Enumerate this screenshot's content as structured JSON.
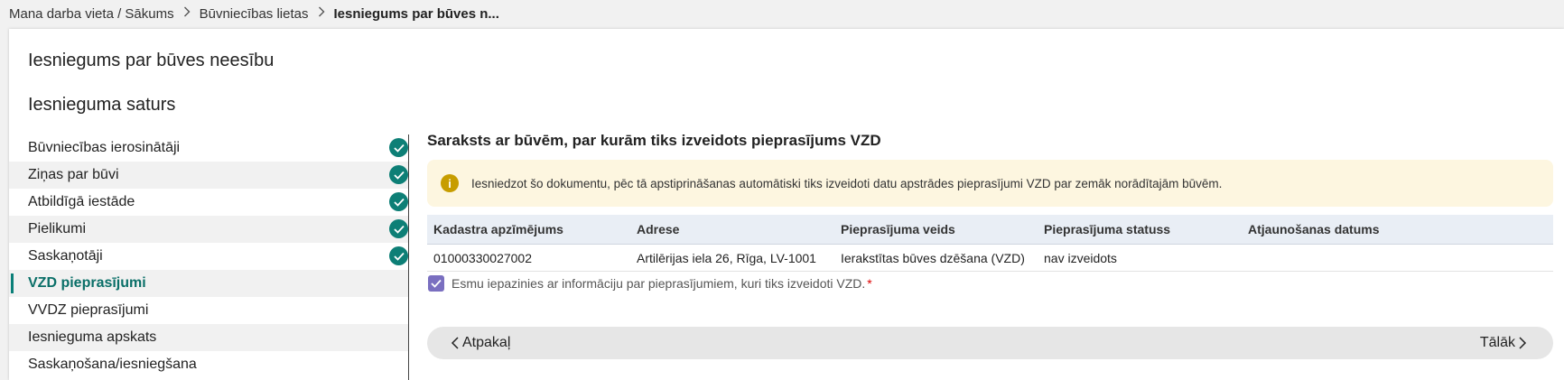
{
  "breadcrumb": {
    "home": "Mana darba vieta / Sākums",
    "section": "Būvniecības lietas",
    "current": "Iesniegums par būves n..."
  },
  "page": {
    "title": "Iesniegums par būves neesību",
    "subtitle": "Iesnieguma saturs"
  },
  "steps": [
    {
      "label": "Būvniecības ierosinātāji",
      "done": true
    },
    {
      "label": "Ziņas par būvi",
      "done": true
    },
    {
      "label": "Atbildīgā iestāde",
      "done": true
    },
    {
      "label": "Pielikumi",
      "done": true
    },
    {
      "label": "Saskaņotāji",
      "done": true
    },
    {
      "label": "VZD pieprasījumi",
      "active": true
    },
    {
      "label": "VVDZ pieprasījumi"
    },
    {
      "label": "Iesnieguma apskats"
    },
    {
      "label": "Saskaņošana/iesniegšana"
    }
  ],
  "main": {
    "section_title": "Saraksts ar būvēm, par kurām tiks izveidots pieprasījums VZD",
    "notice": "Iesniedzot šo dokumentu, pēc tā apstiprināšanas automātiski tiks izveidoti datu apstrādes pieprasījumi VZD par zemāk norādītajām būvēm.",
    "table": {
      "headers": [
        "Kadastra apzīmējums",
        "Adrese",
        "Pieprasījuma veids",
        "Pieprasījuma statuss",
        "Atjaunošanas datums"
      ],
      "rows": [
        [
          "01000330027002",
          "Artilērijas iela 26, Rīga, LV-1001",
          "Ierakstītas būves dzēšana (VZD)",
          "nav izveidots",
          ""
        ]
      ]
    },
    "confirm_label": "Esmu iepazinies ar informāciju par pieprasījumiem, kuri tiks izveidoti VZD.",
    "confirm_required": "*",
    "confirm_checked": true,
    "back_label": "Atpakaļ",
    "next_label": "Tālāk"
  },
  "colors": {
    "accent": "#0d7f76",
    "notice_bg": "#fdf6e0",
    "notice_icon": "#c79d00",
    "checkbox": "#7a6fc0",
    "required": "#dd0000"
  },
  "icons": {
    "step_done": "check-circle-icon",
    "notice": "info-icon",
    "back": "chevron-left-icon",
    "next": "chevron-right-icon",
    "breadcrumb_sep": "chevron-right-icon"
  }
}
